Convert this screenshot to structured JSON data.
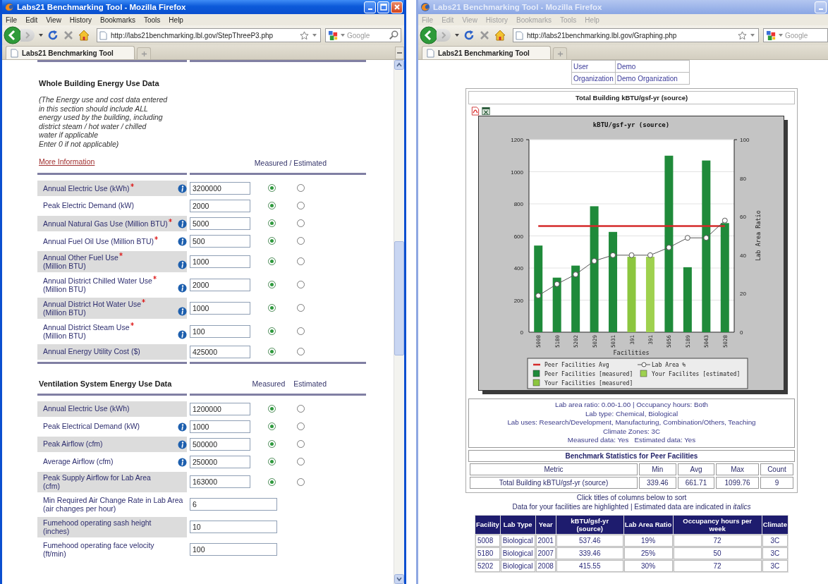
{
  "windows": [
    {
      "title": "Labs21 Benchmarking Tool - Mozilla Firefox",
      "active": true,
      "controls": [
        {
          "kind": "minimize"
        },
        {
          "kind": "maximize"
        },
        {
          "kind": "close"
        }
      ],
      "menu": [
        "File",
        "Edit",
        "View",
        "History",
        "Bookmarks",
        "Tools",
        "Help"
      ],
      "address": "http://labs21benchmarking.lbl.gov/StepThreeP3.php",
      "search_placeholder": "Google",
      "tabs": [
        {
          "label": "Labs21 Benchmarking Tool",
          "selected": true
        }
      ],
      "tab_list_button": true,
      "page": {
        "kind": "form",
        "sections": [
          {
            "title": "Whole Building Energy Use Data",
            "note": "(The Energy use and cost data entered\nin this section should include ALL\nenergy used by the building, including\ndistrict steam / hot water / chilled\nwater if applicable\nEnter 0 if not applicable)",
            "link": "More Information",
            "columns": [
              "Measured / Estimated"
            ],
            "rows": [
              {
                "kind": "radio",
                "label": "Annual Electric Use (kWh)",
                "required": true,
                "info": true,
                "value": "3200000",
                "measured": true
              },
              {
                "kind": "radio",
                "label": "Peak Electric Demand (kW)",
                "info": false,
                "value": "2000",
                "measured": true
              },
              {
                "kind": "radio",
                "label": "Annual Natural Gas Use (Million BTU)",
                "required": true,
                "info": true,
                "value": "5000",
                "measured": true
              },
              {
                "kind": "radio",
                "label": "Annual Fuel Oil Use (Million BTU)",
                "required": true,
                "info": true,
                "value": "500",
                "measured": true
              },
              {
                "kind": "radio",
                "label": "Annual Other Fuel Use",
                "required": true,
                "line2": "(Million BTU)",
                "info": true,
                "value": "1000",
                "measured": true
              },
              {
                "kind": "radio",
                "label": "Annual District Chilled Water Use",
                "required": true,
                "line2": "(Million BTU)",
                "info": true,
                "value": "2000",
                "measured": true
              },
              {
                "kind": "radio",
                "label": "Annual District Hot Water Use",
                "required": true,
                "line2": "(Million BTU)",
                "info": true,
                "value": "1000",
                "measured": true
              },
              {
                "kind": "radio",
                "label": "Annual District Steam Use",
                "required": true,
                "line2": "(Million BTU)",
                "info": true,
                "value": "100",
                "measured": true
              },
              {
                "kind": "radio",
                "label": "Annual Energy Utility Cost ($)",
                "info": false,
                "value": "425000",
                "measured": true
              }
            ]
          },
          {
            "title": "Ventilation System Energy Use Data",
            "columns": [
              "Measured",
              "Estimated"
            ],
            "rows": [
              {
                "kind": "radio",
                "label": "Annual Electric Use (kWh)",
                "info": false,
                "value": "1200000",
                "measured": true
              },
              {
                "kind": "radio",
                "label": "Peak Electrical Demand (kW)",
                "info": true,
                "value": "1000",
                "measured": true
              },
              {
                "kind": "radio",
                "label": "Peak Airflow (cfm)",
                "info": true,
                "value": "500000",
                "measured": true
              },
              {
                "kind": "radio",
                "label": "Average Airflow (cfm)",
                "info": true,
                "value": "250000",
                "measured": true
              },
              {
                "kind": "radio",
                "label": "Peak Supply Airflow for Lab Area",
                "line2": "(cfm)",
                "info": false,
                "value": "163000",
                "measured": true
              },
              {
                "kind": "wide",
                "label": "Min Required Air Change Rate in Lab Area",
                "line2": "(air changes per hour)",
                "info": false,
                "value": "6"
              },
              {
                "kind": "wide",
                "label": "Fumehood operating sash height",
                "line2": "(inches)",
                "info": false,
                "value": "10"
              },
              {
                "kind": "wide",
                "label": "Fumehood operating face velocity",
                "line2": "(ft/min)",
                "info": false,
                "value": "100"
              }
            ]
          }
        ]
      }
    },
    {
      "title": "Labs21 Benchmarking Tool - Mozilla Firefox",
      "active": false,
      "controls": [
        {
          "kind": "minimize"
        }
      ],
      "menu": [
        "File",
        "Edit",
        "View",
        "History",
        "Bookmarks",
        "Tools",
        "Help"
      ],
      "address": "http://labs21benchmarking.lbl.gov/Graphing.php",
      "search_placeholder": "Google",
      "tabs": [
        {
          "label": "Labs21 Benchmarking Tool",
          "selected": true
        }
      ],
      "page": {
        "kind": "report",
        "user_table": [
          {
            "label": "User",
            "value": "Demo"
          },
          {
            "label": "Organization",
            "value": "Demo Organization"
          }
        ],
        "panel_title": "Total Building kBTU/gsf-yr (source)",
        "chart_data": {
          "type": "bar",
          "title": "kBTU/gsf-yr (source)",
          "xlabel": "Facilities",
          "y2label": "Lab Area Ratio",
          "categories": [
            "5008",
            "5180",
            "5202",
            "5029",
            "5031",
            "391",
            "391",
            "5056",
            "5189",
            "5043",
            "5028"
          ],
          "grid": true,
          "legend": true,
          "ylim": [
            0,
            1200
          ],
          "yticks": [
            0,
            200,
            400,
            600,
            800,
            1000,
            1200
          ],
          "y2lim": [
            0,
            100
          ],
          "y2ticks": [
            0,
            20,
            40,
            60,
            80,
            100
          ],
          "series": [
            {
              "name": "Peer Facilities Avg",
              "type": "line",
              "color": "#d42a2a",
              "values": [
                662,
                662,
                662,
                662,
                662,
                662,
                662,
                662,
                662,
                662,
                662
              ]
            },
            {
              "name": "Lab Area %",
              "type": "line",
              "axis": "y2",
              "marker": "circle",
              "color": "#555555",
              "values": [
                19,
                25,
                30,
                37,
                40,
                40,
                40,
                44,
                49,
                49,
                58
              ]
            },
            {
              "name": "Peer Facilities [measured]",
              "type": "bar",
              "color": "#1f8a3a",
              "values": [
                540,
                340,
                415,
                785,
                625,
                null,
                null,
                1100,
                405,
                1070,
                680
              ]
            },
            {
              "name": "Your Facilites [estimated]",
              "type": "bar",
              "color": "#9fd14f",
              "values": [
                null,
                null,
                null,
                null,
                null,
                null,
                470,
                null,
                null,
                null,
                null
              ]
            },
            {
              "name": "Your Facilities [measured]",
              "type": "bar",
              "color": "#8cc63f",
              "values": [
                null,
                null,
                null,
                null,
                null,
                470,
                null,
                null,
                null,
                null,
                null
              ]
            }
          ]
        },
        "filters": [
          "Lab area ratio: 0.00-1.00 | Occupancy hours: Both",
          "Lab type: Chemical, Biological",
          "Lab uses: Research/Development, Manufacturing, Combination/Others, Teaching",
          "Climate Zones: 3C",
          "Measured data: Yes   Estimated data: Yes"
        ],
        "stats": {
          "title": "Benchmark Statistics for Peer Facilities",
          "columns": [
            "Metric",
            "Min",
            "Avg",
            "Max",
            "Count"
          ],
          "rows": [
            [
              "Total Building kBTU/gsf-yr (source)",
              "339.46",
              "661.71",
              "1099.76",
              "9"
            ]
          ]
        },
        "sort_notes": [
          "Click titles of columns below to sort",
          "Data for your facilities are highlighted | Estimated data are indicated in *italics*"
        ],
        "facilities": {
          "columns": [
            "Facility",
            "Lab Type",
            "Year",
            "kBTU/gsf-yr (source)",
            "Lab Area Ratio",
            "Occupancy hours per week",
            "Climate"
          ],
          "rows": [
            [
              "5008",
              "Biological",
              "2001",
              "537.46",
              "19%",
              "72",
              "3C"
            ],
            [
              "5180",
              "Biological",
              "2007",
              "339.46",
              "25%",
              "50",
              "3C"
            ],
            [
              "5202",
              "Biological",
              "2008",
              "415.55",
              "30%",
              "72",
              "3C"
            ]
          ]
        }
      }
    }
  ]
}
